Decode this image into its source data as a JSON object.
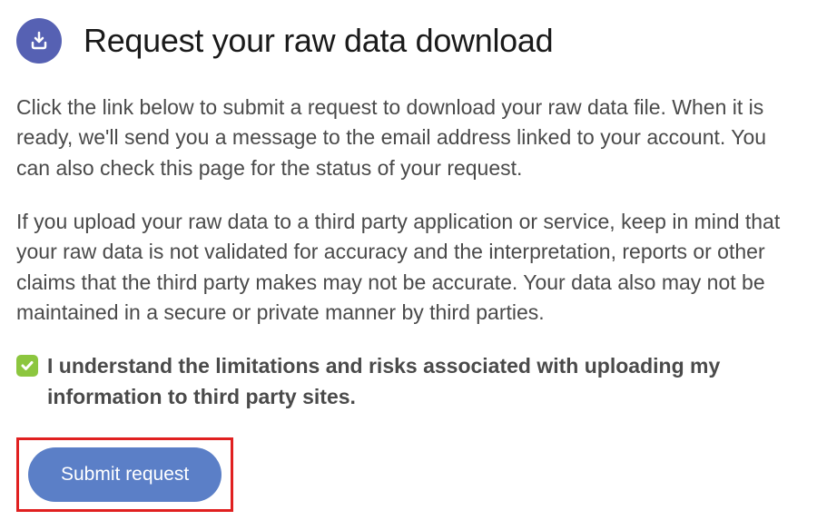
{
  "header": {
    "title": "Request your raw data download"
  },
  "body": {
    "paragraph1": "Click the link below to submit a request to download your raw data file. When it is ready, we'll send you a message to the email address linked to your account. You can also check this page for the status of your request.",
    "paragraph2": "If you upload your raw data to a third party application or service, keep in mind that your raw data is not validated for accuracy and the interpretation, reports or other claims that the third party makes may not be accurate. Your data also may not be maintained in a secure or private manner by third parties."
  },
  "consent": {
    "checked": true,
    "label": "I understand the limitations and risks associated with uploading my information to third party sites."
  },
  "actions": {
    "submit_label": "Submit request"
  }
}
